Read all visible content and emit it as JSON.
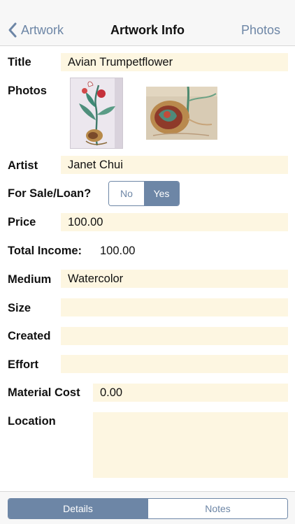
{
  "nav": {
    "back_label": "Artwork",
    "title": "Artwork Info",
    "right_label": "Photos"
  },
  "form": {
    "title_label": "Title",
    "title_value": "Avian Trumpetflower",
    "photos_label": "Photos",
    "artist_label": "Artist",
    "artist_value": "Janet Chui",
    "for_sale_label": "For Sale/Loan?",
    "for_sale_options": [
      "No",
      "Yes"
    ],
    "for_sale_selected": "Yes",
    "price_label": "Price",
    "price_value": "100.00",
    "total_income_label": "Total Income:",
    "total_income_value": "100.00",
    "medium_label": "Medium",
    "medium_value": "Watercolor",
    "size_label": "Size",
    "size_value": "",
    "created_label": "Created",
    "created_value": "",
    "effort_label": "Effort",
    "effort_value": "",
    "material_cost_label": "Material Cost",
    "material_cost_value": "0.00",
    "location_label": "Location",
    "location_value": ""
  },
  "tabs": {
    "items": [
      "Details",
      "Notes"
    ],
    "selected": "Details"
  },
  "colors": {
    "accent": "#6d86a6",
    "field_bg": "#fdf6e1"
  }
}
